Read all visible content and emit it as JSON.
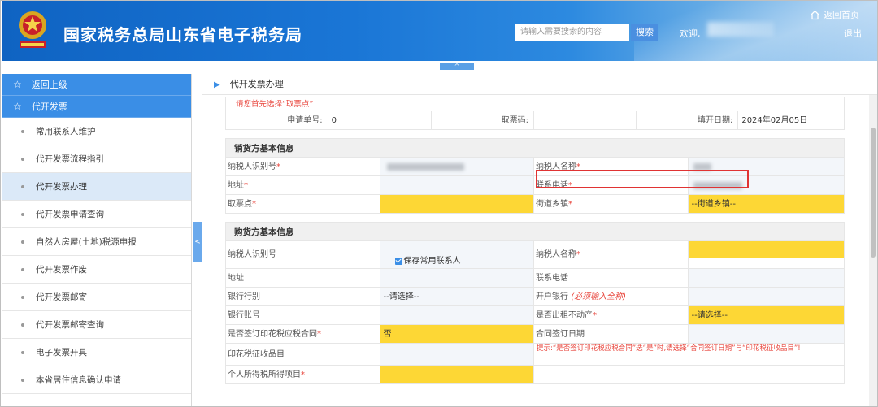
{
  "header": {
    "site_title": "国家税务总局山东省电子税务局",
    "search_placeholder": "请输入需要搜索的内容",
    "search_button": "搜索",
    "welcome": "欢迎,",
    "home_link": "返回首页",
    "logout": "退出",
    "collapse_glyph": "^"
  },
  "sidebar": {
    "back": "返回上级",
    "section": "代开发票",
    "items": [
      {
        "label": "常用联系人维护"
      },
      {
        "label": "代开发票流程指引"
      },
      {
        "label": "代开发票办理"
      },
      {
        "label": "代开发票申请查询"
      },
      {
        "label": "自然人房屋(土地)税源申报"
      },
      {
        "label": "代开发票作废"
      },
      {
        "label": "代开发票邮寄"
      },
      {
        "label": "代开发票邮寄查询"
      },
      {
        "label": "电子发票开具"
      },
      {
        "label": "本省居住信息确认申请"
      }
    ],
    "toggle_glyph": "<"
  },
  "page": {
    "breadcrumb": "代开发票办理",
    "notice": "请您首先选择“取票点”",
    "app_no_label": "申请单号:",
    "app_no_value": "0",
    "pickup_code_label": "取票码:",
    "fill_date_label": "填开日期:",
    "fill_date_value": "2024年02月05日"
  },
  "seller": {
    "section": "销货方基本信息",
    "taxpayer_id": "纳税人识别号",
    "taxpayer_name": "纳税人名称",
    "address": "地址",
    "phone": "联系电话",
    "pickup_point": "取票点",
    "street": "街道乡镇",
    "street_value": "--街道乡镇--"
  },
  "buyer": {
    "section": "购货方基本信息",
    "taxpayer_id": "纳税人识别号",
    "save_contact": "保存常用联系人",
    "taxpayer_name": "纳税人名称",
    "address": "地址",
    "phone": "联系电话",
    "bank_type": "银行行别",
    "bank_type_value": "--请选择--",
    "bank": "开户银行",
    "bank_hint": "(必须输入全称)",
    "account": "银行账号",
    "rent": "是否出租不动产",
    "rent_value": "--请选择--",
    "stamp_contract": "是否签订印花税应税合同",
    "stamp_contract_value": "否",
    "contract_date": "合同签订日期",
    "stamp_item": "印花税征收品目",
    "tip": "提示:“是否签订印花税应税合同”选“是”时,请选择“合同签订日期”与“印花税征收品目”!",
    "income_item": "个人所得税所得项目"
  },
  "colors": {
    "accent": "#3a8ee6",
    "required": "#e8453c",
    "highlight": "#fdd735",
    "callout": "#e03333"
  }
}
